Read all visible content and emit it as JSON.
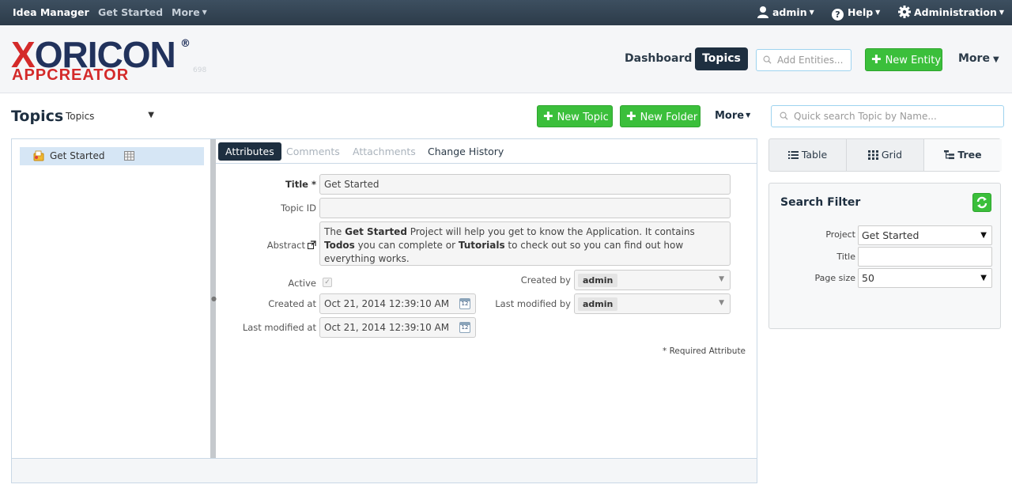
{
  "topbar": {
    "brand": "Idea Manager",
    "nav_get_started": "Get Started",
    "nav_more": "More",
    "user": "admin",
    "help": "Help",
    "administration": "Administration"
  },
  "header": {
    "logo_text": "XORICON",
    "logo_sub": "APPCREATOR",
    "logo_version": "698",
    "dashboard": "Dashboard",
    "topics": "Topics",
    "add_entities_placeholder": "Add Entities...",
    "new_entity": "New Entity",
    "more": "More"
  },
  "title_row": {
    "title": "Topics",
    "selector": "Topics",
    "new_topic": "New Topic",
    "new_folder": "New Folder",
    "more": "More",
    "quick_search_placeholder": "Quick search Topic by Name..."
  },
  "tree": {
    "items": [
      {
        "label": "Get Started"
      }
    ]
  },
  "tabs": {
    "attributes": "Attributes",
    "comments": "Comments",
    "attachments": "Attachments",
    "change_history": "Change History"
  },
  "form": {
    "title_label": "Title *",
    "title_value": "Get Started",
    "topic_id_label": "Topic ID",
    "topic_id_value": "",
    "abstract_label": "Abstract",
    "abstract_parts": {
      "p1": "The ",
      "b1": "Get Started",
      "p2": " Project will help you get to know the Application. It contains ",
      "b2": "Todos",
      "p3": " you can complete or ",
      "b3": "Tutorials",
      "p4": " to check out so you can find out how everything works."
    },
    "active_label": "Active",
    "active_checked": true,
    "created_at_label": "Created at",
    "created_at_value": "Oct 21, 2014 12:39:10 AM",
    "last_modified_at_label": "Last modified at",
    "last_modified_at_value": "Oct 21, 2014 12:39:10 AM",
    "created_by_label": "Created by",
    "created_by_value": "admin",
    "last_modified_by_label": "Last modified by",
    "last_modified_by_value": "admin",
    "calendar_day": "12",
    "required_note": "* Required Attribute"
  },
  "view_switch": {
    "table": "Table",
    "grid": "Grid",
    "tree": "Tree"
  },
  "search_filter": {
    "title": "Search Filter",
    "project_label": "Project",
    "project_value": "Get Started",
    "title_label": "Title",
    "title_value": "",
    "page_size_label": "Page size",
    "page_size_value": "50"
  },
  "colors": {
    "navbar": "#2c3b49",
    "accent_dark": "#1e2f40",
    "green": "#3bbf3b",
    "logo_red": "#d42a2a",
    "logo_navy": "#21325c",
    "selection": "#d6e6f5"
  }
}
